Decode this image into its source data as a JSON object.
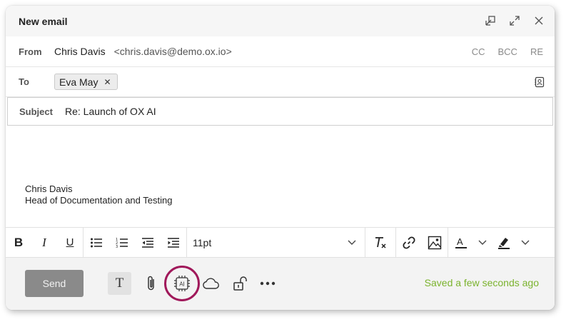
{
  "window": {
    "title": "New email"
  },
  "from": {
    "label": "From",
    "name": "Chris Davis",
    "email": "<chris.davis@demo.ox.io>"
  },
  "cc_options": [
    "CC",
    "BCC",
    "RE"
  ],
  "to": {
    "label": "To",
    "recipients": [
      {
        "name": "Eva May"
      }
    ]
  },
  "subject": {
    "label": "Subject",
    "value": "Re: Launch of OX AI"
  },
  "body": {
    "signature": [
      "Chris Davis",
      "Head of Documentation and Testing"
    ]
  },
  "toolbar": {
    "font_size": "11pt"
  },
  "footer": {
    "send_label": "Send",
    "text_icon_glyph": "T",
    "ai_label": "AI",
    "status": "Saved a few seconds ago"
  },
  "colors": {
    "accent_green": "#7bb32e",
    "ai_highlight": "#a0185a",
    "send_bg": "#8a8a8a"
  }
}
